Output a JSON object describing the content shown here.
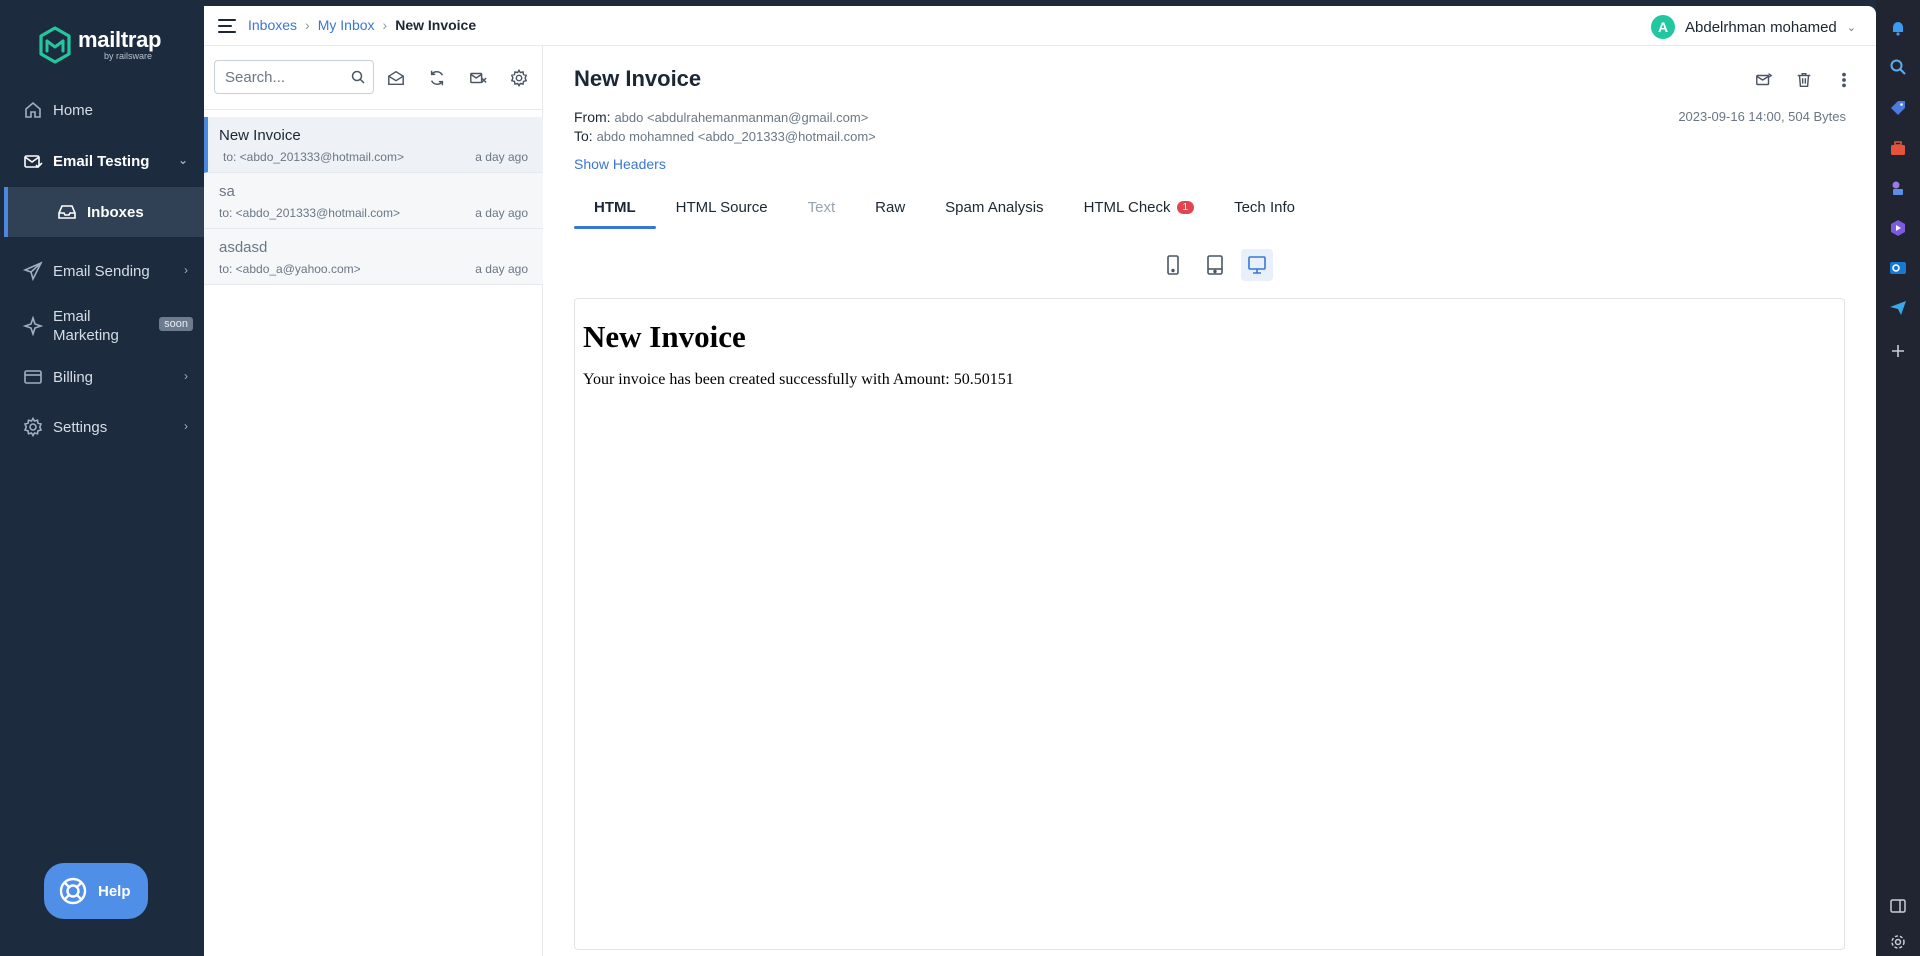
{
  "brand": {
    "name": "mailtrap",
    "sub": "by railsware"
  },
  "sidebar": {
    "home": "Home",
    "email_testing": "Email Testing",
    "inboxes": "Inboxes",
    "email_sending": "Email Sending",
    "email_marketing_line1": "Email",
    "email_marketing_line2": "Marketing",
    "soon": "soon",
    "billing": "Billing",
    "settings": "Settings",
    "help": "Help"
  },
  "breadcrumb": {
    "inboxes": "Inboxes",
    "my_inbox": "My Inbox",
    "current": "New Invoice",
    "sep": "›"
  },
  "user": {
    "initial": "A",
    "name": "Abdelrhman mohamed"
  },
  "search": {
    "placeholder": "Search..."
  },
  "messages": [
    {
      "subject": "New Invoice",
      "to": "to: <abdo_201333@hotmail.com>",
      "when": "a day ago"
    },
    {
      "subject": "sa",
      "to": "to: <abdo_201333@hotmail.com>",
      "when": "a day ago"
    },
    {
      "subject": "asdasd",
      "to": "to: <abdo_a@yahoo.com>",
      "when": "a day ago"
    }
  ],
  "view": {
    "title": "New Invoice",
    "from_label": "From:",
    "from": "abdo <abdulrahemanmanman@gmail.com>",
    "to_label": "To:",
    "to": "abdo mohamned <abdo_201333@hotmail.com>",
    "meta": "2023-09-16 14:00, 504 Bytes",
    "show_headers": "Show Headers",
    "tabs": [
      "HTML",
      "HTML Source",
      "Text",
      "Raw",
      "Spam Analysis",
      "HTML Check",
      "Tech Info"
    ],
    "html_check_badge": "1"
  },
  "preview": {
    "heading": "New Invoice",
    "body": "Your invoice has been created successfully with Amount: 50.50151"
  },
  "colors": {
    "accent": "#3a76d6",
    "sidebar_bg": "#1c2b3e",
    "badge": "#e2454d",
    "avatar": "#22c7a0"
  }
}
